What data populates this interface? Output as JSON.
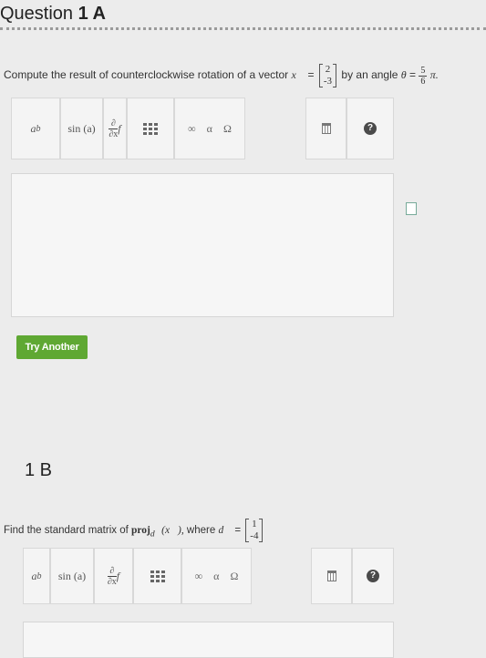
{
  "question": {
    "title_prefix": "Question ",
    "title_bold": "1 A",
    "prompt_text": "Compute the result of counterclockwise rotation of a vector",
    "vector_symbol": "x⃗",
    "equals": "=",
    "vector": [
      "2",
      "-3"
    ],
    "angle_text": "by an angle",
    "theta": "θ",
    "angle_num": "5",
    "angle_den": "6",
    "pi": "π."
  },
  "toolbar": {
    "power": "a",
    "power_sup": "b",
    "sin": "sin (a)",
    "deriv_num": "∂",
    "deriv_den": "∂x",
    "deriv_f": "f",
    "infinity": "∞",
    "alpha": "α",
    "omega": "Ω",
    "help": "?"
  },
  "try_another": "Try Another",
  "part_b": {
    "title": "1 B",
    "prompt_text": "Find the standard matrix of",
    "proj": "proj",
    "proj_sub": "d⃗",
    "proj_arg": "(x⃗),",
    "where": "where",
    "d_symbol": "d⃗",
    "equals": "=",
    "vector": [
      "1",
      "-4"
    ]
  },
  "toolbar_b": {
    "power": "a",
    "power_sup": "b",
    "sin": "sin (a)",
    "deriv_num": "∂",
    "deriv_den": "∂x",
    "deriv_f": "f",
    "infinity": "∞",
    "alpha": "α",
    "omega": "Ω",
    "help": "?"
  }
}
